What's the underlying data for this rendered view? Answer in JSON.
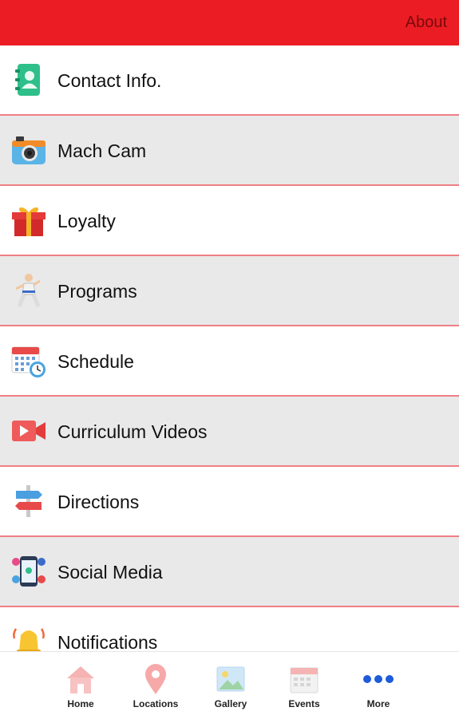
{
  "header": {
    "about_label": "About",
    "color": "#ec1c24"
  },
  "menu": {
    "items": [
      {
        "label": "Contact Info.",
        "icon": "contact-book-icon"
      },
      {
        "label": "Mach Cam",
        "icon": "camera-icon"
      },
      {
        "label": "Loyalty",
        "icon": "gift-icon"
      },
      {
        "label": "Programs",
        "icon": "karate-figure-icon"
      },
      {
        "label": "Schedule",
        "icon": "calendar-clock-icon"
      },
      {
        "label": "Curriculum Videos",
        "icon": "video-camera-icon"
      },
      {
        "label": "Directions",
        "icon": "signpost-icon"
      },
      {
        "label": "Social Media",
        "icon": "social-phone-icon"
      },
      {
        "label": "Notifications",
        "icon": "bell-icon"
      }
    ]
  },
  "tabbar": {
    "tabs": [
      {
        "label": "Home",
        "icon": "home-icon"
      },
      {
        "label": "Locations",
        "icon": "location-pin-icon"
      },
      {
        "label": "Gallery",
        "icon": "gallery-icon"
      },
      {
        "label": "Events",
        "icon": "calendar-icon"
      },
      {
        "label": "More",
        "icon": "more-dots-icon"
      }
    ]
  }
}
